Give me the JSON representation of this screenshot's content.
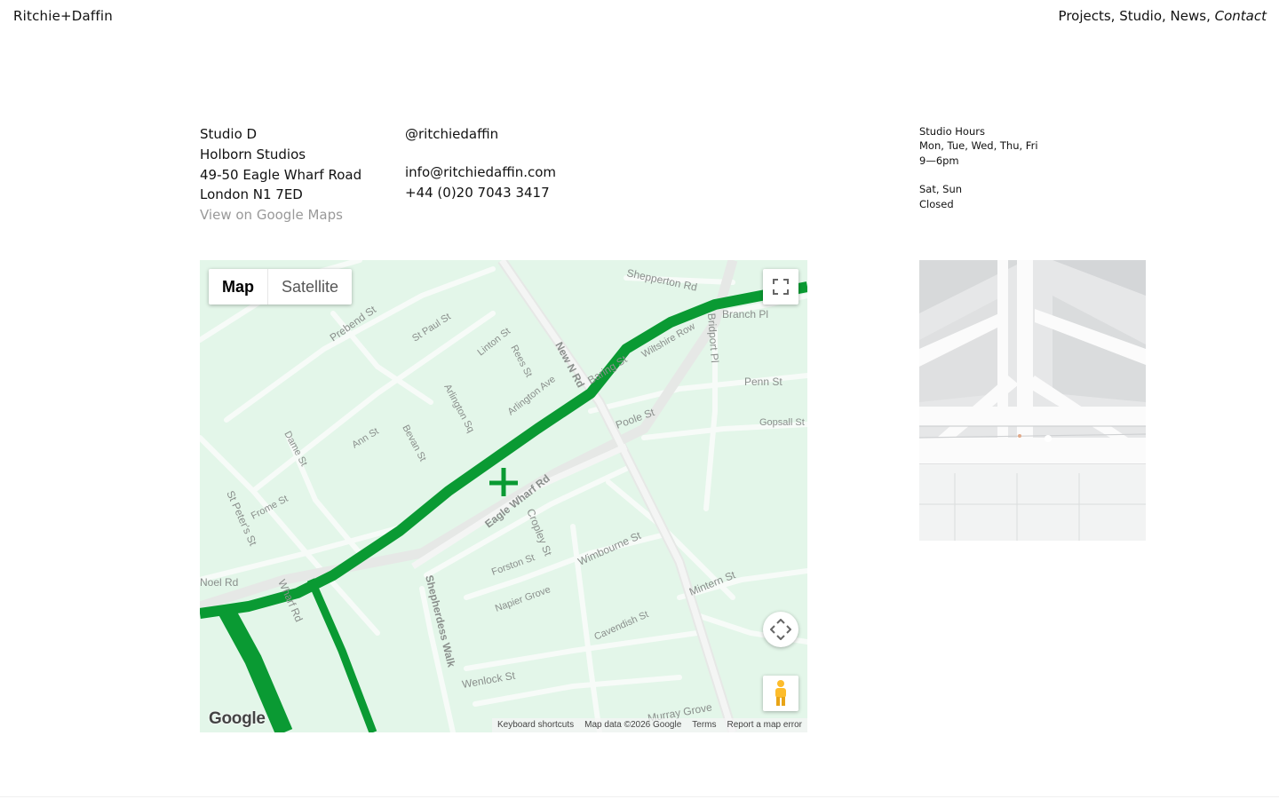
{
  "header": {
    "brand": "Ritchie+Daffin",
    "nav": [
      {
        "label": "Projects",
        "sep": ", "
      },
      {
        "label": "Studio",
        "sep": ", "
      },
      {
        "label": "News",
        "sep": ", "
      },
      {
        "label": "Contact",
        "sep": ""
      }
    ]
  },
  "address": {
    "line1": "Studio D",
    "line2": "Holborn Studios",
    "line3": "49-50 Eagle Wharf Road",
    "line4": "London N1 7ED",
    "map_link": "View on Google Maps"
  },
  "contact": {
    "instagram": "@ritchiedaffin",
    "email": "info@ritchiedaffin.com",
    "phone": "+44 (0)20 7043 3417"
  },
  "hours": {
    "title": "Studio Hours",
    "weekdays": "Mon, Tue, Wed, Thu, Fri",
    "weekday_hours": "9—6pm",
    "weekend": "Sat, Sun",
    "weekend_hours": "Closed"
  },
  "map": {
    "type_map": "Map",
    "type_satellite": "Satellite",
    "logo": "Google",
    "attribution": {
      "shortcuts": "Keyboard shortcuts",
      "data": "Map data ©2026 Google",
      "terms": "Terms",
      "report": "Report a map error"
    },
    "colors": {
      "background": "#e3f6e9",
      "canal": "#0a9a33",
      "road": "#ffffff"
    },
    "street_labels": [
      "Shepperton Rd",
      "Branch Pl",
      "Bridport Pl",
      "Penn St",
      "Gopsall St",
      "Baring St",
      "Wiltshire Row",
      "New N Rd",
      "Poole St",
      "Prebend St",
      "St Paul St",
      "Linton St",
      "Rees St",
      "Arlington Ave",
      "Arlington Sq",
      "Dame St",
      "Ann St",
      "Bevan St",
      "St Peter's St",
      "Frome St",
      "Noel Rd",
      "Wharf Rd",
      "Eagle Wharf Rd",
      "Cropley St",
      "Forston St",
      "Wimbourne St",
      "Napier Grove",
      "Mintern St",
      "Cavendish St",
      "Shepherdess Walk",
      "Wenlock St",
      "Murray Grove"
    ]
  },
  "photo": {
    "alt": "White painted roof trusses in studio"
  }
}
